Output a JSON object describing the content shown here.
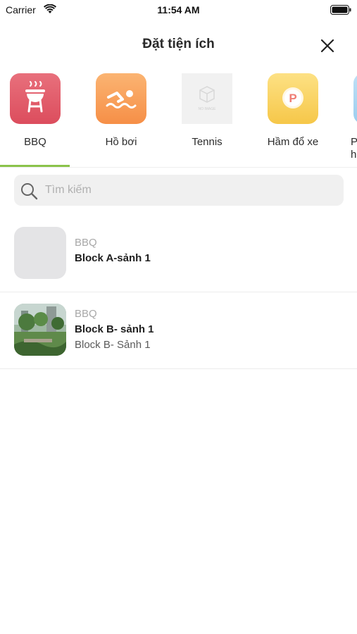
{
  "status_bar": {
    "carrier": "Carrier",
    "time": "11:54 AM",
    "icons": [
      "wifi-icon",
      "battery-icon"
    ]
  },
  "header": {
    "title": "Đặt tiện ích",
    "close_icon": "close-icon"
  },
  "categories": {
    "active_index": 0,
    "accent_color": "#8bc34a",
    "items": [
      {
        "label": "BBQ",
        "icon": "grill-icon",
        "color": "#e15a68"
      },
      {
        "label": "Hồ bơi",
        "icon": "swimmer-icon",
        "color": "#f79d55"
      },
      {
        "label": "Tennis",
        "icon": "no-image-placeholder",
        "placeholder_text": "NO IMAGE"
      },
      {
        "label": "Hầm đổ xe",
        "icon": "parking-icon",
        "color": "#f8d162",
        "badge_letter": "P"
      },
      {
        "label": "P ho",
        "icon": "partial-category-icon",
        "color": "#aad5f1"
      }
    ]
  },
  "search": {
    "placeholder": "Tìm kiếm",
    "value": ""
  },
  "list": [
    {
      "category": "BBQ",
      "name": "Block A-sảnh 1",
      "address": "",
      "thumb": "empty-thumbnail"
    },
    {
      "category": "BBQ",
      "name": "Block B- sảnh 1",
      "address": "Block B- Sảnh 1",
      "thumb": "garden-photo"
    }
  ]
}
